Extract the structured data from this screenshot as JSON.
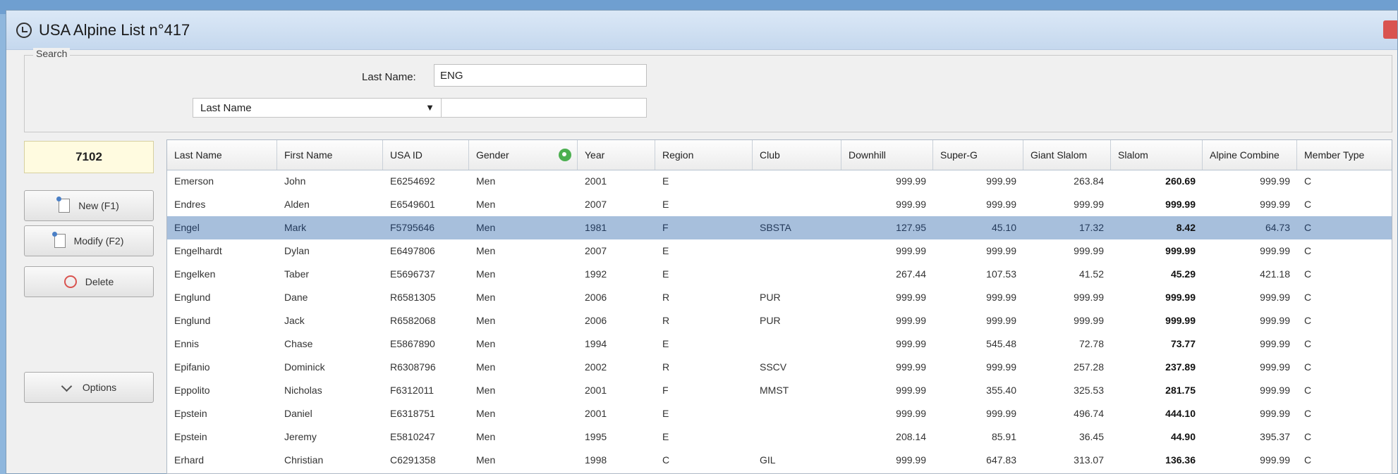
{
  "window": {
    "title": "USA Alpine List n°417"
  },
  "search": {
    "legend": "Search",
    "last_name_label": "Last Name:",
    "last_name_value": "ENG",
    "field_select": "Last Name",
    "field_value": ""
  },
  "sidebar": {
    "count": "7102",
    "new_label": "New (F1)",
    "modify_label": "Modify (F2)",
    "delete_label": "Delete",
    "options_label": "Options"
  },
  "table": {
    "columns": [
      "Last Name",
      "First Name",
      "USA ID",
      "Gender",
      "Year",
      "Region",
      "Club",
      "Downhill",
      "Super-G",
      "Giant Slalom",
      "Slalom",
      "Alpine Combine",
      "Member Type"
    ],
    "rows": [
      [
        "Emerson",
        "John",
        "E6254692",
        "Men",
        "2001",
        "E",
        "",
        "999.99",
        "999.99",
        "263.84",
        "260.69",
        "999.99",
        "C"
      ],
      [
        "Endres",
        "Alden",
        "E6549601",
        "Men",
        "2007",
        "E",
        "",
        "999.99",
        "999.99",
        "999.99",
        "999.99",
        "999.99",
        "C"
      ],
      [
        "Engel",
        "Mark",
        "F5795646",
        "Men",
        "1981",
        "F",
        "SBSTA",
        "127.95",
        "45.10",
        "17.32",
        "8.42",
        "64.73",
        "C"
      ],
      [
        "Engelhardt",
        "Dylan",
        "E6497806",
        "Men",
        "2007",
        "E",
        "",
        "999.99",
        "999.99",
        "999.99",
        "999.99",
        "999.99",
        "C"
      ],
      [
        "Engelken",
        "Taber",
        "E5696737",
        "Men",
        "1992",
        "E",
        "",
        "267.44",
        "107.53",
        "41.52",
        "45.29",
        "421.18",
        "C"
      ],
      [
        "Englund",
        "Dane",
        "R6581305",
        "Men",
        "2006",
        "R",
        "PUR",
        "999.99",
        "999.99",
        "999.99",
        "999.99",
        "999.99",
        "C"
      ],
      [
        "Englund",
        "Jack",
        "R6582068",
        "Men",
        "2006",
        "R",
        "PUR",
        "999.99",
        "999.99",
        "999.99",
        "999.99",
        "999.99",
        "C"
      ],
      [
        "Ennis",
        "Chase",
        "E5867890",
        "Men",
        "1994",
        "E",
        "",
        "999.99",
        "545.48",
        "72.78",
        "73.77",
        "999.99",
        "C"
      ],
      [
        "Epifanio",
        "Dominick",
        "R6308796",
        "Men",
        "2002",
        "R",
        "SSCV",
        "999.99",
        "999.99",
        "257.28",
        "237.89",
        "999.99",
        "C"
      ],
      [
        "Eppolito",
        "Nicholas",
        "F6312011",
        "Men",
        "2001",
        "F",
        "MMST",
        "999.99",
        "355.40",
        "325.53",
        "281.75",
        "999.99",
        "C"
      ],
      [
        "Epstein",
        "Daniel",
        "E6318751",
        "Men",
        "2001",
        "E",
        "",
        "999.99",
        "999.99",
        "496.74",
        "444.10",
        "999.99",
        "C"
      ],
      [
        "Epstein",
        "Jeremy",
        "E5810247",
        "Men",
        "1995",
        "E",
        "",
        "208.14",
        "85.91",
        "36.45",
        "44.90",
        "395.37",
        "C"
      ],
      [
        "Erhard",
        "Christian",
        "C6291358",
        "Men",
        "1998",
        "C",
        "GIL",
        "999.99",
        "647.83",
        "313.07",
        "136.36",
        "999.99",
        "C"
      ]
    ]
  }
}
